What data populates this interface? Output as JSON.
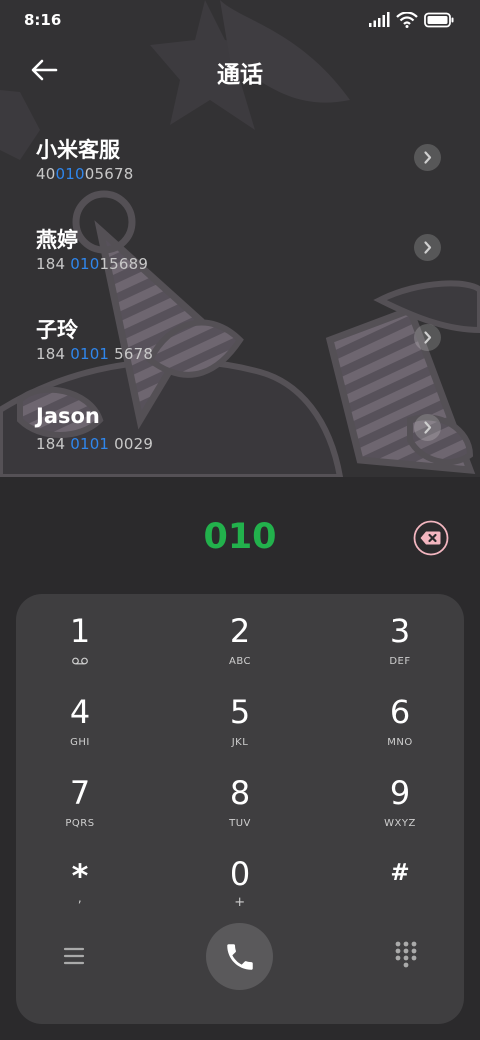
{
  "status": {
    "time": "8:16"
  },
  "header": {
    "title": "通话"
  },
  "results": [
    {
      "name": "小米客服",
      "number_pre": "40",
      "number_match": "010",
      "number_post": "05678"
    },
    {
      "name": "燕婷",
      "number_pre": "184 ",
      "number_match": "010",
      "number_post": "15689"
    },
    {
      "name": "子玲",
      "number_pre": "184 ",
      "number_match": "0101",
      "number_post": " 5678"
    },
    {
      "name": "Jason",
      "number_pre": "184 ",
      "number_match": "0101",
      "number_post": " 0029"
    }
  ],
  "dialer": {
    "input": "010"
  },
  "keypad": {
    "keys": [
      {
        "digit": "1",
        "letters": ""
      },
      {
        "digit": "2",
        "letters": "ABC"
      },
      {
        "digit": "3",
        "letters": "DEF"
      },
      {
        "digit": "4",
        "letters": "GHI"
      },
      {
        "digit": "5",
        "letters": "JKL"
      },
      {
        "digit": "6",
        "letters": "MNO"
      },
      {
        "digit": "7",
        "letters": "PQRS"
      },
      {
        "digit": "8",
        "letters": "TUV"
      },
      {
        "digit": "9",
        "letters": "WXYZ"
      },
      {
        "digit": "*",
        "letters": ","
      },
      {
        "digit": "0",
        "letters": "+"
      },
      {
        "digit": "#",
        "letters": ""
      }
    ]
  },
  "colors": {
    "match_highlight": "#2f86ec",
    "dial_digits": "#22b14c",
    "delete_accent": "#f3b6c0"
  },
  "icons": {
    "voicemail": "voicemail-icon",
    "menu": "menu-icon",
    "call": "phone-icon",
    "hide_keypad": "keypad-grid-icon",
    "delete": "backspace-icon",
    "back": "back-arrow-icon"
  }
}
